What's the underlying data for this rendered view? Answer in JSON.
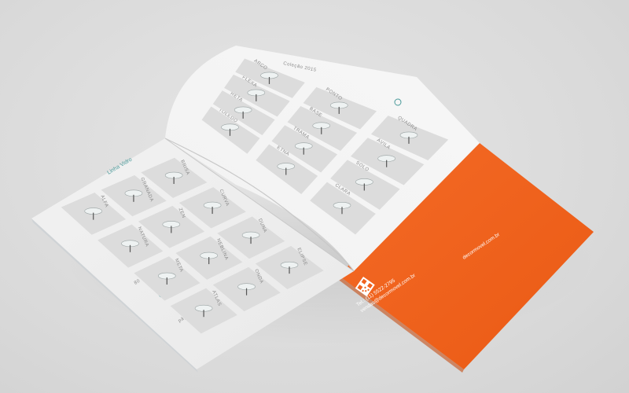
{
  "catalog": {
    "left_page": {
      "section_title": "Linha Vidro",
      "folio_left": "80",
      "folio_right": "pág. 12",
      "product_labels": [
        "ALFA",
        "GRANADA",
        "BRISA",
        "NATURA",
        "ZEN",
        "CURVA",
        "META",
        "NEBLINA",
        "DUNA",
        "ATLAS",
        "ONDA",
        "ELIPSE"
      ]
    },
    "right_page": {
      "section_title": "Coleção 2015",
      "product_labels": [
        "TOLEDO",
        "RETA",
        "FLEXA",
        "ARCO",
        "ETNA",
        "TRAMA",
        "BASE",
        "PONTO",
        "CLARA",
        "SOLO",
        "ÁVILA",
        "QUADRA"
      ]
    },
    "back_cover": {
      "phone": "Tel.: (11) 5522-2795",
      "email": "vendas@decormovel.com.br",
      "website": "decormovel.com.br",
      "color": "#f0621e"
    }
  }
}
